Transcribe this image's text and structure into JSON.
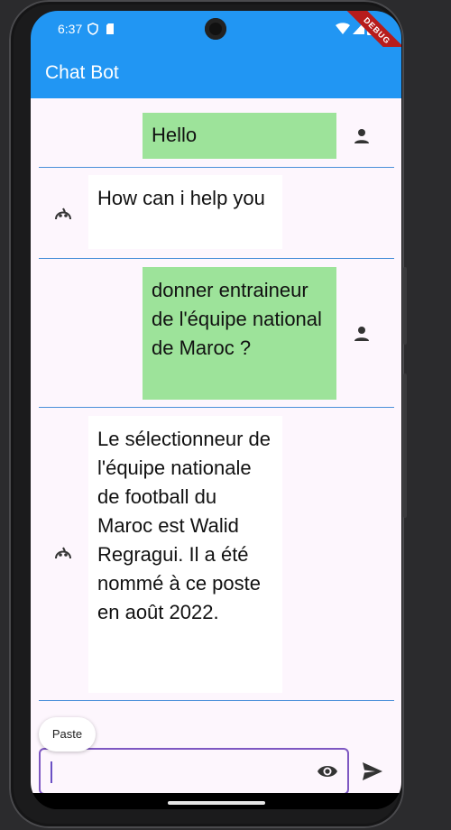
{
  "status_bar": {
    "time": "6:37"
  },
  "app_bar": {
    "title": "Chat Bot",
    "debug_label": "DEBUG"
  },
  "messages": [
    {
      "sender": "user",
      "text": "Hello"
    },
    {
      "sender": "bot",
      "text": "How can i help you"
    },
    {
      "sender": "user",
      "text": "donner entraineur de l'équipe national de Maroc ?"
    },
    {
      "sender": "bot",
      "text": "Le sélectionneur de l'équipe nationale de football du Maroc est Walid Regragui. Il a été nommé à ce poste en août 2022."
    }
  ],
  "composer": {
    "paste_label": "Paste",
    "value": ""
  },
  "colors": {
    "primary": "#2196f3",
    "user_bubble": "#9de39a",
    "bot_bubble": "#ffffff",
    "input_border": "#7e57c2",
    "divider": "#4a90d9"
  },
  "icons": {
    "user": "person-icon",
    "bot": "robot-icon",
    "visibility": "eye-icon",
    "send": "send-icon"
  }
}
